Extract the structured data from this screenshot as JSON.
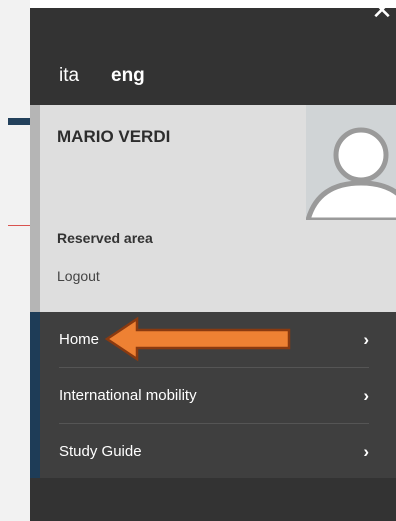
{
  "close": {
    "glyph": "✕"
  },
  "languages": {
    "ita": "ita",
    "eng": "eng"
  },
  "user": {
    "name": "MARIO VERDI"
  },
  "account": {
    "reserved_area": "Reserved area",
    "logout": "Logout"
  },
  "nav": {
    "items": [
      {
        "label": "Home",
        "chevron": "›"
      },
      {
        "label": "International mobility",
        "chevron": "›"
      },
      {
        "label": "Study Guide",
        "chevron": "›"
      }
    ]
  },
  "colors": {
    "drawer_dark": "#333333",
    "nav_bg": "#3f3f3f",
    "nav_accent": "#1e3c57",
    "panel_bg": "#dedede",
    "highlight_arrow": "#ee8133"
  }
}
